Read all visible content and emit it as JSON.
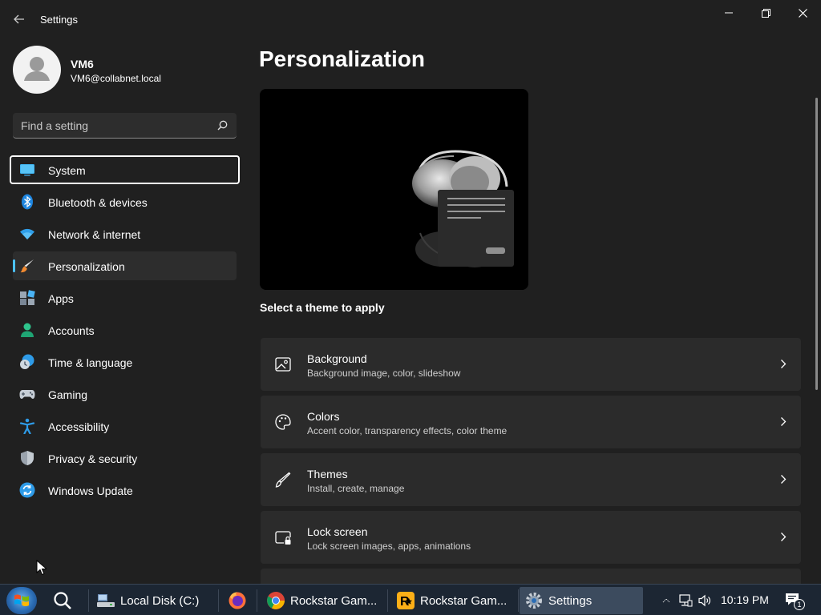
{
  "window": {
    "app_title": "Settings",
    "back_icon": "back-arrow-icon",
    "controls": [
      "minimize-icon",
      "restore-icon",
      "close-icon"
    ]
  },
  "profile": {
    "name": "VM6",
    "email": "VM6@collabnet.local"
  },
  "search": {
    "placeholder": "Find a setting",
    "value": ""
  },
  "sidebar": {
    "items": [
      {
        "label": "System",
        "icon": "system-icon",
        "state": "focused"
      },
      {
        "label": "Bluetooth & devices",
        "icon": "bluetooth-icon"
      },
      {
        "label": "Network & internet",
        "icon": "wifi-icon"
      },
      {
        "label": "Personalization",
        "icon": "brush-icon",
        "state": "selected"
      },
      {
        "label": "Apps",
        "icon": "apps-icon"
      },
      {
        "label": "Accounts",
        "icon": "person-icon"
      },
      {
        "label": "Time & language",
        "icon": "clock-globe-icon"
      },
      {
        "label": "Gaming",
        "icon": "gamepad-icon"
      },
      {
        "label": "Accessibility",
        "icon": "accessibility-icon"
      },
      {
        "label": "Privacy & security",
        "icon": "shield-icon"
      },
      {
        "label": "Windows Update",
        "icon": "update-icon"
      }
    ]
  },
  "main": {
    "page_title": "Personalization",
    "theme_label": "Select a theme to apply",
    "cards": [
      {
        "title": "Background",
        "subtitle": "Background image, color, slideshow",
        "icon": "image-icon"
      },
      {
        "title": "Colors",
        "subtitle": "Accent color, transparency effects, color theme",
        "icon": "palette-icon"
      },
      {
        "title": "Themes",
        "subtitle": "Install, create, manage",
        "icon": "pen-icon"
      },
      {
        "title": "Lock screen",
        "subtitle": "Lock screen images, apps, animations",
        "icon": "lock-screen-icon"
      }
    ]
  },
  "taskbar": {
    "items": [
      {
        "label": "Local Disk (C:)",
        "icon": "folder-drive-icon"
      },
      {
        "label": "",
        "icon": "firefox-icon"
      },
      {
        "label": "Rockstar Gam...",
        "icon": "chrome-icon"
      },
      {
        "label": "Rockstar Gam...",
        "icon": "rockstar-icon"
      },
      {
        "label": "Settings",
        "icon": "settings-gear-icon",
        "state": "active"
      }
    ],
    "clock": "10:19 PM",
    "notification_count": "1"
  },
  "colors": {
    "background": "#202020",
    "accent": "#4cc2ff",
    "card": "#2b2b2b",
    "taskbar": "#1c2633"
  }
}
